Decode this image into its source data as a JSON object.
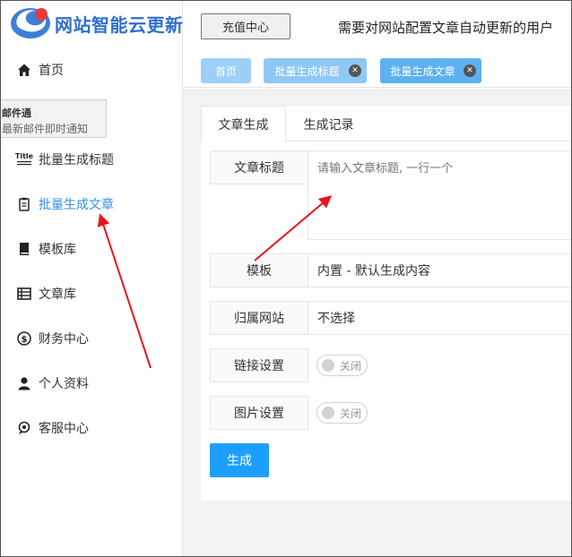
{
  "brand": {
    "title": "网站智能云更新",
    "color": "#2f6fcf"
  },
  "sidebar": {
    "items": [
      {
        "label": "首页",
        "icon": "home-icon"
      },
      {
        "label": "批量生成标题",
        "icon": "title-icon",
        "icon_text": "Title"
      },
      {
        "label": "批量生成文章",
        "icon": "article-icon",
        "active": true
      },
      {
        "label": "模板库",
        "icon": "book-icon"
      },
      {
        "label": "文章库",
        "icon": "list-icon"
      },
      {
        "label": "财务中心",
        "icon": "dollar-icon"
      },
      {
        "label": "个人资料",
        "icon": "user-icon"
      },
      {
        "label": "客服中心",
        "icon": "support-icon"
      }
    ],
    "active_color": "#2f8fe6"
  },
  "notification": {
    "title": "邮件通",
    "text": "最新邮件即时通知"
  },
  "topbar": {
    "recharge_label": "充值中心",
    "notice": "需要对网站配置文章自动更新的用户"
  },
  "page_tabs": [
    {
      "label": "首页"
    },
    {
      "label": "批量生成标题",
      "closable": true
    },
    {
      "label": "批量生成文章",
      "closable": true,
      "active": true
    }
  ],
  "card": {
    "tabs": [
      {
        "label": "文章生成",
        "active": true
      },
      {
        "label": "生成记录"
      }
    ],
    "fields": {
      "title": {
        "label": "文章标题",
        "placeholder": "请输入文章标题, 一行一个"
      },
      "template": {
        "label": "模板",
        "value": "内置 - 默认生成内容"
      },
      "site": {
        "label": "归属网站",
        "value": "不选择"
      },
      "link_settings": {
        "label": "链接设置",
        "toggle_text": "关闭",
        "on": false
      },
      "image_settings": {
        "label": "图片设置",
        "toggle_text": "关闭",
        "on": false
      }
    },
    "generate_label": "生成"
  },
  "colors": {
    "primary": "#1e9fff",
    "arrow": "#e8141e"
  }
}
